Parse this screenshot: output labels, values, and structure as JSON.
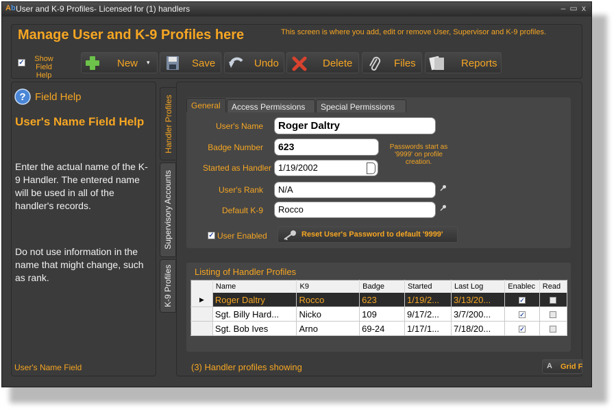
{
  "window": {
    "title": "User and K-9 Profiles- Licensed for (1) handlers",
    "min_glyph": "–",
    "max_glyph": "▭",
    "close_glyph": "x"
  },
  "header": {
    "title": "Manage User and K-9 Profiles here",
    "description": "This screen is where you add, edit or remove User, Supervisor and K-9 profiles."
  },
  "toolbar": {
    "show_field_help_line1": "Show Field",
    "show_field_help_line2": "Help",
    "show_field_help_checked": true,
    "new_label": "New",
    "save_label": "Save",
    "undo_label": "Undo",
    "delete_label": "Delete",
    "files_label": "Files",
    "reports_label": "Reports"
  },
  "help": {
    "header": "Field Help",
    "title": "User's Name Field Help",
    "para1": "Enter the actual name of the K-9 Handler. The entered name will be used in all of the handler's records.",
    "para2": "Do not use information in the name that might change, such as rank.",
    "footer": "User's Name Field"
  },
  "vertical_tabs": [
    "Handler Profiles",
    "Supervisory Accounts",
    "K-9 Profiles"
  ],
  "form_tabs": [
    "General",
    "Access Permissions",
    "Special Permissions"
  ],
  "form": {
    "users_name_label": "User's Name",
    "users_name": "Roger Daltry",
    "badge_label": "Badge Number",
    "badge": "623",
    "password_note": "Passwords start as '9999' on profile creation.",
    "started_label": "Started as Handler",
    "started": "1/19/2002",
    "rank_label": "User's Rank",
    "rank": "N/A",
    "k9_label": "Default K-9",
    "k9": "Rocco",
    "enabled_label": "User Enabled",
    "enabled": true,
    "reset_label": "Reset User's Password to default '9999'"
  },
  "listing": {
    "title": "Listing of Handler Profiles",
    "columns": [
      "Name",
      "K9",
      "Badge",
      "Started",
      "Last Log",
      "Enablec",
      "Read"
    ],
    "rows": [
      {
        "name": "Roger Daltry",
        "k9": "Rocco",
        "badge": "623",
        "started": "1/19/2...",
        "last": "3/13/20...",
        "enabled": true,
        "read": false
      },
      {
        "name": "Sgt. Billy Hard...",
        "k9": "Nicko",
        "badge": "109",
        "started": "9/17/2...",
        "last": "3/7/200...",
        "enabled": true,
        "read": false
      },
      {
        "name": "Sgt. Bob Ives",
        "k9": "Arno",
        "badge": "69-24",
        "started": "1/17/1...",
        "last": "7/18/20...",
        "enabled": true,
        "read": false
      }
    ],
    "status": "(3) Handler profiles showing",
    "grid_font_label": "Grid F"
  },
  "colors": {
    "accent": "#f6a623",
    "background": "#3b3b3b"
  }
}
